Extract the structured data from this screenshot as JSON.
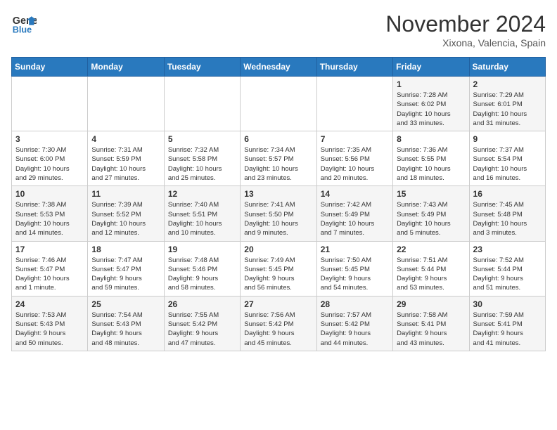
{
  "header": {
    "logo_line1": "General",
    "logo_line2": "Blue",
    "month_title": "November 2024",
    "location": "Xixona, Valencia, Spain"
  },
  "weekdays": [
    "Sunday",
    "Monday",
    "Tuesday",
    "Wednesday",
    "Thursday",
    "Friday",
    "Saturday"
  ],
  "weeks": [
    [
      {
        "day": "",
        "info": ""
      },
      {
        "day": "",
        "info": ""
      },
      {
        "day": "",
        "info": ""
      },
      {
        "day": "",
        "info": ""
      },
      {
        "day": "",
        "info": ""
      },
      {
        "day": "1",
        "info": "Sunrise: 7:28 AM\nSunset: 6:02 PM\nDaylight: 10 hours\nand 33 minutes."
      },
      {
        "day": "2",
        "info": "Sunrise: 7:29 AM\nSunset: 6:01 PM\nDaylight: 10 hours\nand 31 minutes."
      }
    ],
    [
      {
        "day": "3",
        "info": "Sunrise: 7:30 AM\nSunset: 6:00 PM\nDaylight: 10 hours\nand 29 minutes."
      },
      {
        "day": "4",
        "info": "Sunrise: 7:31 AM\nSunset: 5:59 PM\nDaylight: 10 hours\nand 27 minutes."
      },
      {
        "day": "5",
        "info": "Sunrise: 7:32 AM\nSunset: 5:58 PM\nDaylight: 10 hours\nand 25 minutes."
      },
      {
        "day": "6",
        "info": "Sunrise: 7:34 AM\nSunset: 5:57 PM\nDaylight: 10 hours\nand 23 minutes."
      },
      {
        "day": "7",
        "info": "Sunrise: 7:35 AM\nSunset: 5:56 PM\nDaylight: 10 hours\nand 20 minutes."
      },
      {
        "day": "8",
        "info": "Sunrise: 7:36 AM\nSunset: 5:55 PM\nDaylight: 10 hours\nand 18 minutes."
      },
      {
        "day": "9",
        "info": "Sunrise: 7:37 AM\nSunset: 5:54 PM\nDaylight: 10 hours\nand 16 minutes."
      }
    ],
    [
      {
        "day": "10",
        "info": "Sunrise: 7:38 AM\nSunset: 5:53 PM\nDaylight: 10 hours\nand 14 minutes."
      },
      {
        "day": "11",
        "info": "Sunrise: 7:39 AM\nSunset: 5:52 PM\nDaylight: 10 hours\nand 12 minutes."
      },
      {
        "day": "12",
        "info": "Sunrise: 7:40 AM\nSunset: 5:51 PM\nDaylight: 10 hours\nand 10 minutes."
      },
      {
        "day": "13",
        "info": "Sunrise: 7:41 AM\nSunset: 5:50 PM\nDaylight: 10 hours\nand 9 minutes."
      },
      {
        "day": "14",
        "info": "Sunrise: 7:42 AM\nSunset: 5:49 PM\nDaylight: 10 hours\nand 7 minutes."
      },
      {
        "day": "15",
        "info": "Sunrise: 7:43 AM\nSunset: 5:49 PM\nDaylight: 10 hours\nand 5 minutes."
      },
      {
        "day": "16",
        "info": "Sunrise: 7:45 AM\nSunset: 5:48 PM\nDaylight: 10 hours\nand 3 minutes."
      }
    ],
    [
      {
        "day": "17",
        "info": "Sunrise: 7:46 AM\nSunset: 5:47 PM\nDaylight: 10 hours\nand 1 minute."
      },
      {
        "day": "18",
        "info": "Sunrise: 7:47 AM\nSunset: 5:47 PM\nDaylight: 9 hours\nand 59 minutes."
      },
      {
        "day": "19",
        "info": "Sunrise: 7:48 AM\nSunset: 5:46 PM\nDaylight: 9 hours\nand 58 minutes."
      },
      {
        "day": "20",
        "info": "Sunrise: 7:49 AM\nSunset: 5:45 PM\nDaylight: 9 hours\nand 56 minutes."
      },
      {
        "day": "21",
        "info": "Sunrise: 7:50 AM\nSunset: 5:45 PM\nDaylight: 9 hours\nand 54 minutes."
      },
      {
        "day": "22",
        "info": "Sunrise: 7:51 AM\nSunset: 5:44 PM\nDaylight: 9 hours\nand 53 minutes."
      },
      {
        "day": "23",
        "info": "Sunrise: 7:52 AM\nSunset: 5:44 PM\nDaylight: 9 hours\nand 51 minutes."
      }
    ],
    [
      {
        "day": "24",
        "info": "Sunrise: 7:53 AM\nSunset: 5:43 PM\nDaylight: 9 hours\nand 50 minutes."
      },
      {
        "day": "25",
        "info": "Sunrise: 7:54 AM\nSunset: 5:43 PM\nDaylight: 9 hours\nand 48 minutes."
      },
      {
        "day": "26",
        "info": "Sunrise: 7:55 AM\nSunset: 5:42 PM\nDaylight: 9 hours\nand 47 minutes."
      },
      {
        "day": "27",
        "info": "Sunrise: 7:56 AM\nSunset: 5:42 PM\nDaylight: 9 hours\nand 45 minutes."
      },
      {
        "day": "28",
        "info": "Sunrise: 7:57 AM\nSunset: 5:42 PM\nDaylight: 9 hours\nand 44 minutes."
      },
      {
        "day": "29",
        "info": "Sunrise: 7:58 AM\nSunset: 5:41 PM\nDaylight: 9 hours\nand 43 minutes."
      },
      {
        "day": "30",
        "info": "Sunrise: 7:59 AM\nSunset: 5:41 PM\nDaylight: 9 hours\nand 41 minutes."
      }
    ]
  ]
}
